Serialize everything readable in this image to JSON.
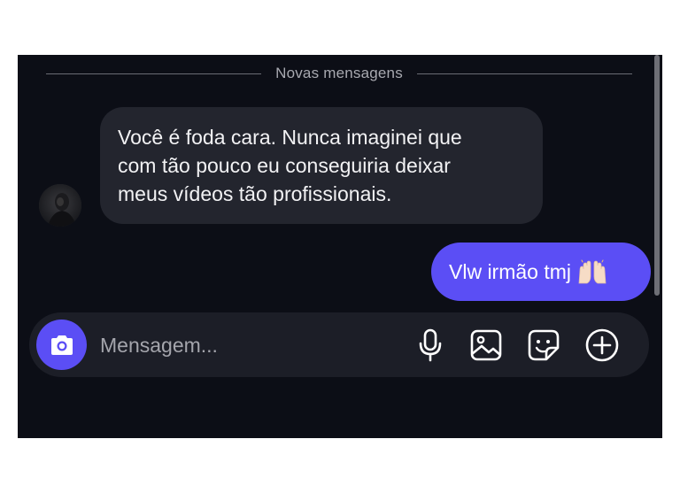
{
  "divider": {
    "label": "Novas mensagens"
  },
  "messages": [
    {
      "direction": "incoming",
      "lines": [
        "Você é foda cara. Nunca imaginei que",
        "com tão pouco eu conseguiria deixar",
        "meus vídeos tão profissionais."
      ]
    },
    {
      "direction": "outgoing",
      "text": "Vlw irmão tmj",
      "emoji": "raising-hands"
    }
  ],
  "composer": {
    "placeholder": "Mensagem...",
    "value": "",
    "icons": [
      "camera-icon",
      "microphone-icon",
      "gallery-icon",
      "sticker-icon",
      "plus-circle-icon"
    ]
  },
  "colors": {
    "background": "#0c0e16",
    "accent": "#5b4ef5",
    "incoming_bubble": "#23252e",
    "composer": "#1c1e27"
  }
}
